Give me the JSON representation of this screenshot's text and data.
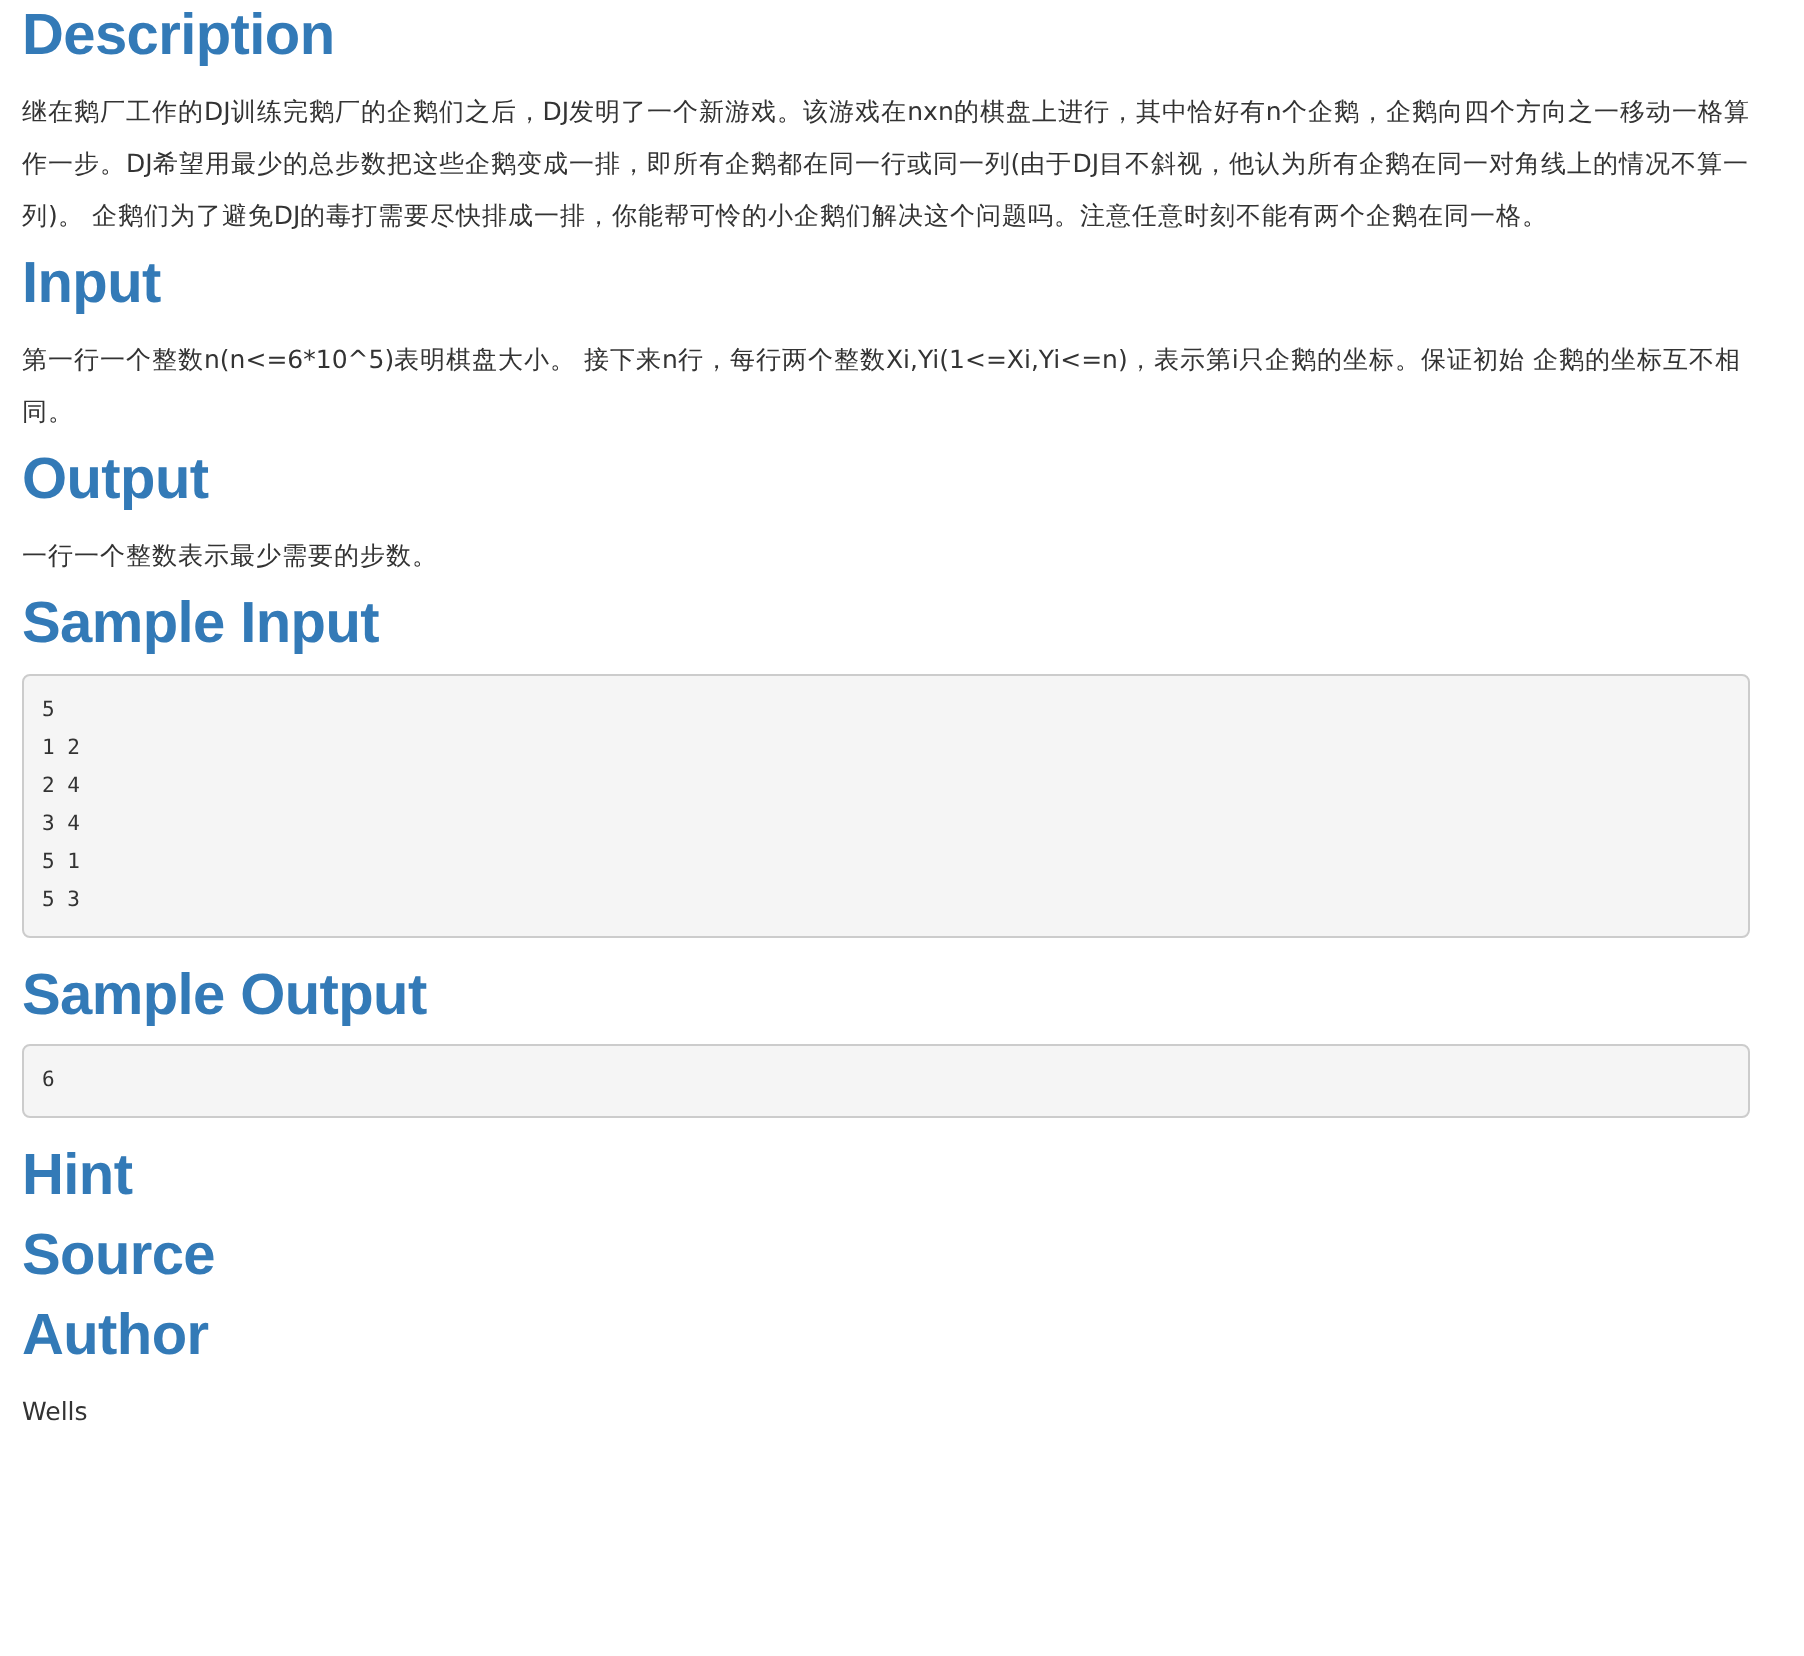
{
  "sections": [
    {
      "kind": "text",
      "heading": "Description",
      "text": "继在鹅厂工作的DJ训练完鹅厂的企鹅们之后，DJ发明了一个新游戏。该游戏在nxn的棋盘上进行，其中恰好有n个企鹅，企鹅向四个方向之一移动一格算作一步。DJ希望用最少的总步数把这些企鹅变成一排，即所有企鹅都在同一行或同一列(由于DJ目不斜视，他认为所有企鹅在同一对角线上的情况不算一列)。 企鹅们为了避免DJ的毒打需要尽快排成一排，你能帮可怜的小企鹅们解决这个问题吗。注意任意时刻不能有两个企鹅在同一格。"
    },
    {
      "kind": "text",
      "heading": "Input",
      "text": "第一行一个整数n(n<=6*10^5)表明棋盘大小。 接下来n行，每行两个整数Xi,Yi(1<=Xi,Yi<=n)，表示第i只企鹅的坐标。保证初始 企鹅的坐标互不相同。"
    },
    {
      "kind": "text",
      "heading": "Output",
      "text": "一行一个整数表示最少需要的步数。"
    },
    {
      "kind": "code",
      "heading": "Sample Input",
      "lines": [
        "5",
        "1 2",
        "2 4",
        "3 4",
        "5 1",
        "5 3"
      ]
    },
    {
      "kind": "code",
      "heading": "Sample Output",
      "lines": [
        "6"
      ]
    },
    {
      "kind": "text",
      "heading": "Hint"
    },
    {
      "kind": "text",
      "heading": "Source"
    },
    {
      "kind": "text",
      "heading": "Author",
      "text": "Wells"
    }
  ]
}
